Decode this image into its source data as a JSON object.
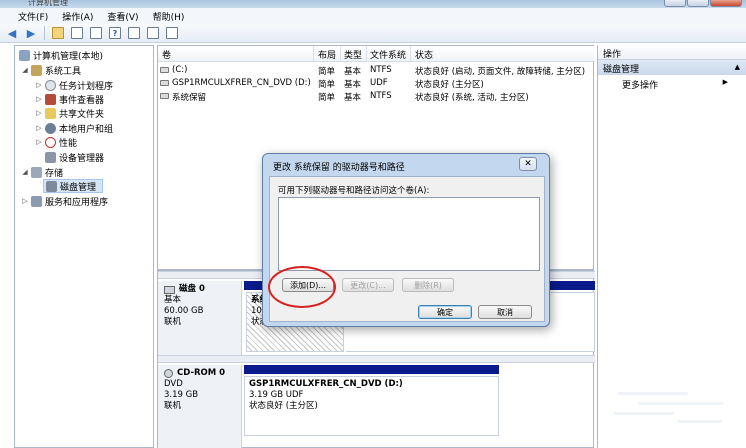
{
  "window": {
    "title": "计算机管理"
  },
  "menu": [
    "文件(F)",
    "操作(A)",
    "查看(V)",
    "帮助(H)"
  ],
  "tree": {
    "root": "计算机管理(本地)",
    "system_tools": "系统工具",
    "items": [
      "任务计划程序",
      "事件查看器",
      "共享文件夹",
      "本地用户和组",
      "性能",
      "设备管理器"
    ],
    "storage": "存储",
    "disk_mgmt": "磁盘管理",
    "services": "服务和应用程序"
  },
  "list": {
    "columns": [
      "卷",
      "布局",
      "类型",
      "文件系统",
      "状态"
    ],
    "rows": [
      {
        "vol": "(C:)",
        "layout": "简单",
        "type": "基本",
        "fs": "NTFS",
        "status": "状态良好 (启动, 页面文件, 故障转储, 主分区)"
      },
      {
        "vol": "GSP1RMCULXFRER_CN_DVD (D:)",
        "layout": "简单",
        "type": "基本",
        "fs": "UDF",
        "status": "状态良好 (主分区)"
      },
      {
        "vol": "系统保留",
        "layout": "简单",
        "type": "基本",
        "fs": "NTFS",
        "status": "状态良好 (系统, 活动, 主分区)"
      }
    ]
  },
  "disks": {
    "disk0": {
      "name": "磁盘 0",
      "type": "基本",
      "size": "60.00 GB",
      "state": "联机",
      "part_name": "系统",
      "part_size": "100",
      "part_status": "状态"
    },
    "cdrom0": {
      "name": "CD-ROM 0",
      "type": "DVD",
      "size": "3.19 GB",
      "state": "联机",
      "part_name": "GSP1RMCULXFRER_CN_DVD  (D:)",
      "part_size": "3.19 GB UDF",
      "part_status": "状态良好 (主分区)"
    }
  },
  "actions": {
    "header": "操作",
    "section": "磁盘管理",
    "more": "更多操作"
  },
  "dialog": {
    "title": "更改 系统保留 的驱动器号和路径",
    "label": "可用下列驱动器号和路径访问这个卷(A):",
    "add": "添加(D)...",
    "change": "更改(C)...",
    "remove": "删除(R)",
    "ok": "确定",
    "cancel": "取消"
  },
  "colors": {
    "partition_bar": "#0a1a8c",
    "highlight_circle": "#d82020"
  }
}
